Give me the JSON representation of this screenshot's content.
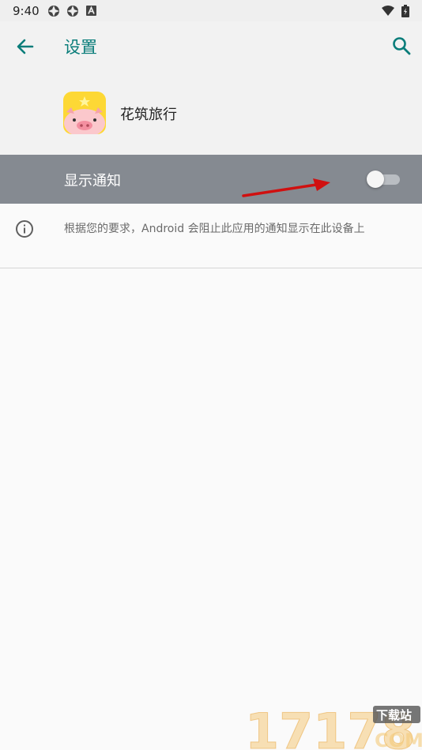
{
  "status_bar": {
    "time": "9:40"
  },
  "app_bar": {
    "title": "设置"
  },
  "app_header": {
    "app_name": "花筑旅行"
  },
  "notification_toggle": {
    "label": "显示通知",
    "enabled": false
  },
  "info": {
    "text": "根据您的要求，Android 会阻止此应用的通知显示在此设备上"
  },
  "watermark": {
    "digits": "17178",
    "badge": "下载站",
    "domain": "COM"
  },
  "colors": {
    "accent": "#0a7d7a",
    "highlight_row": "#858a91",
    "arrow": "#d01010"
  }
}
